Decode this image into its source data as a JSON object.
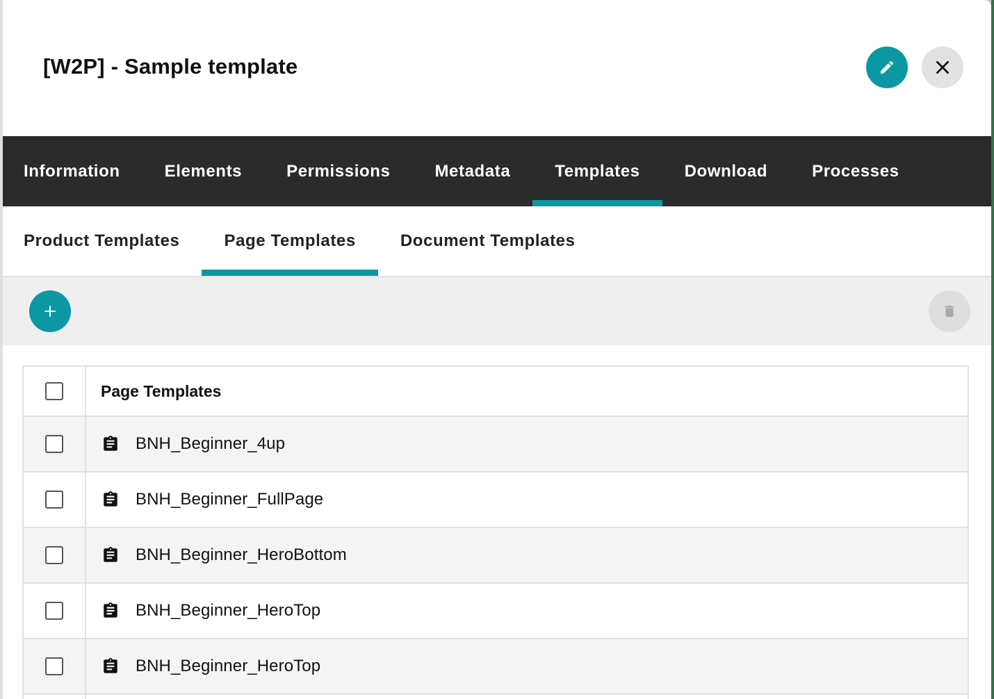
{
  "dialog": {
    "title": "[W2P] - Sample template"
  },
  "main_tabs": [
    {
      "label": "Information"
    },
    {
      "label": "Elements"
    },
    {
      "label": "Permissions"
    },
    {
      "label": "Metadata"
    },
    {
      "label": "Templates",
      "active": true
    },
    {
      "label": "Download"
    },
    {
      "label": "Processes"
    }
  ],
  "sub_tabs": [
    {
      "label": "Product Templates"
    },
    {
      "label": "Page Templates",
      "active": true
    },
    {
      "label": "Document Templates"
    }
  ],
  "toolbar": {
    "add_icon": "plus-icon",
    "delete_icon": "trash-icon"
  },
  "table": {
    "column_header": "Page Templates",
    "rows": [
      {
        "name": "BNH_Beginner_4up",
        "icon": "clipboard-icon"
      },
      {
        "name": "BNH_Beginner_FullPage",
        "icon": "clipboard-icon"
      },
      {
        "name": "BNH_Beginner_HeroBottom",
        "icon": "clipboard-icon"
      },
      {
        "name": "BNH_Beginner_HeroTop",
        "icon": "clipboard-icon"
      },
      {
        "name": "BNH_Beginner_HeroTop",
        "icon": "clipboard-icon"
      }
    ]
  },
  "colors": {
    "accent": "#0c98a3",
    "tab_bar": "#2b2b2b",
    "toolbar_bg": "#efefef",
    "row_shade": "#f4f4f4"
  }
}
